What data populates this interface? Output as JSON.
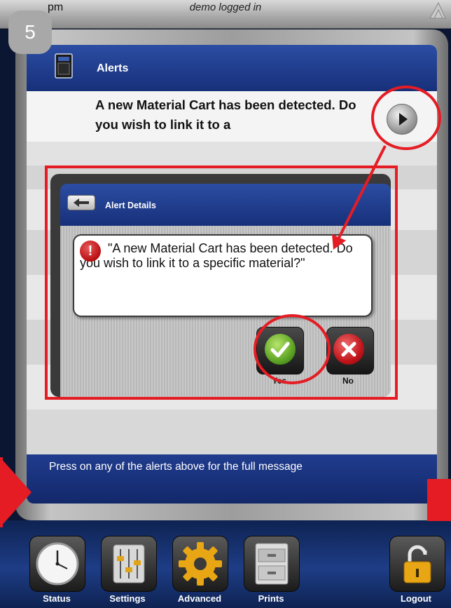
{
  "topbar": {
    "time_fragment": "pm",
    "user_status": "demo logged in"
  },
  "step_badge": "5",
  "screen": {
    "title": "Alerts",
    "alert_text": "A new Material Cart has been detected. Do you wish to link it to a",
    "footer_text": "Press on any of the alerts above for the full message"
  },
  "alert_details": {
    "title": "Alert Details",
    "message": "\"A new Material Cart has been detected. Do you wish to link it to a specific material?\"",
    "warning_glyph": "!",
    "yes_label": "Yes",
    "no_label": "No"
  },
  "toolbar": {
    "status": "Status",
    "settings": "Settings",
    "advanced": "Advanced",
    "prints": "Prints",
    "logout": "Logout"
  },
  "colors": {
    "highlight_red": "#e51c24",
    "header_blue": "#1f3c8c",
    "yes_green": "#5ea425",
    "no_red": "#c1151b"
  },
  "icons": {
    "device": "printer-device-icon",
    "play": "play-icon",
    "back": "back-arrow-icon",
    "warning": "warning-icon",
    "yes": "checkmark-icon",
    "no": "x-icon",
    "status": "clock-icon",
    "settings": "sliders-icon",
    "advanced": "gear-icon",
    "prints": "file-cabinet-icon",
    "logout": "padlock-icon"
  }
}
